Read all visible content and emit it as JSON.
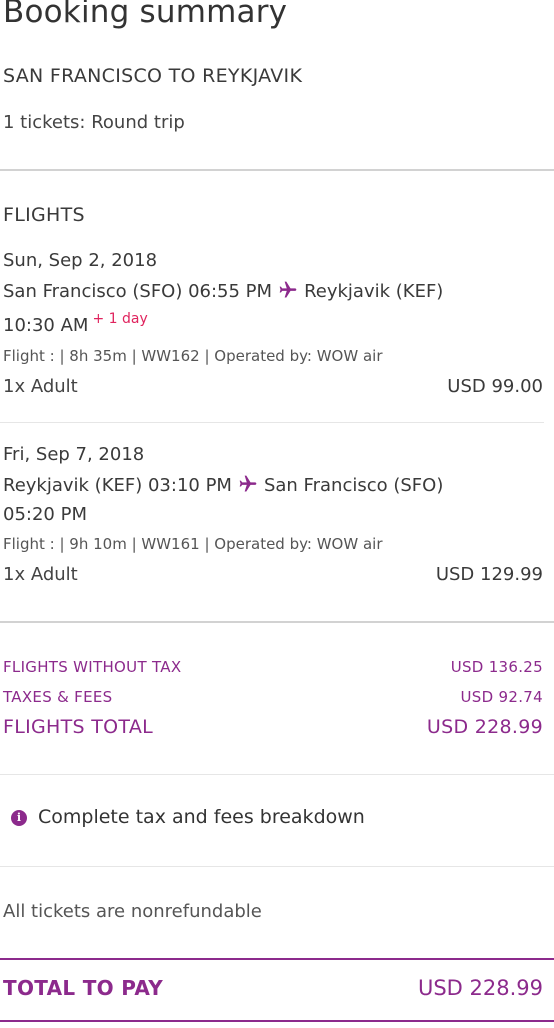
{
  "header": {
    "title": "Booking summary",
    "route": "SAN FRANCISCO TO REYKJAVIK",
    "tickets": "1 tickets: Round trip"
  },
  "flights": {
    "heading": "FLIGHTS",
    "legs": [
      {
        "date": "Sun, Sep 2, 2018",
        "origin": "San Francisco (SFO) 06:55 PM",
        "destination": "Reykjavik (KEF)",
        "arrival_time": "10:30 AM",
        "day_offset": "+ 1 day",
        "details": "Flight : | 8h 35m | WW162 | Operated by: WOW air",
        "passengers": "1x Adult",
        "price": "USD 99.00"
      },
      {
        "date": "Fri, Sep 7, 2018",
        "origin": "Reykjavik (KEF) 03:10 PM",
        "destination": "San Francisco (SFO)",
        "arrival_time": "05:20 PM",
        "details": "Flight : | 9h 10m | WW161 | Operated by: WOW air",
        "passengers": "1x Adult",
        "price": "USD 129.99"
      }
    ]
  },
  "summary": {
    "without_tax_label": "FLIGHTS WITHOUT TAX",
    "without_tax_value": "USD 136.25",
    "taxes_label": "TAXES & FEES",
    "taxes_value": "USD 92.74",
    "total_label": "FLIGHTS TOTAL",
    "total_value": "USD 228.99"
  },
  "breakdown_link": "Complete tax and fees breakdown",
  "info_icon": "info-icon",
  "plane_icon": "plane-icon",
  "nonrefundable_note": "All tickets are nonrefundable",
  "total_to_pay": {
    "label": "TOTAL TO PAY",
    "value": "USD 228.99"
  },
  "colors": {
    "accent": "#8c2a8c",
    "day_offset": "#e0245e"
  }
}
